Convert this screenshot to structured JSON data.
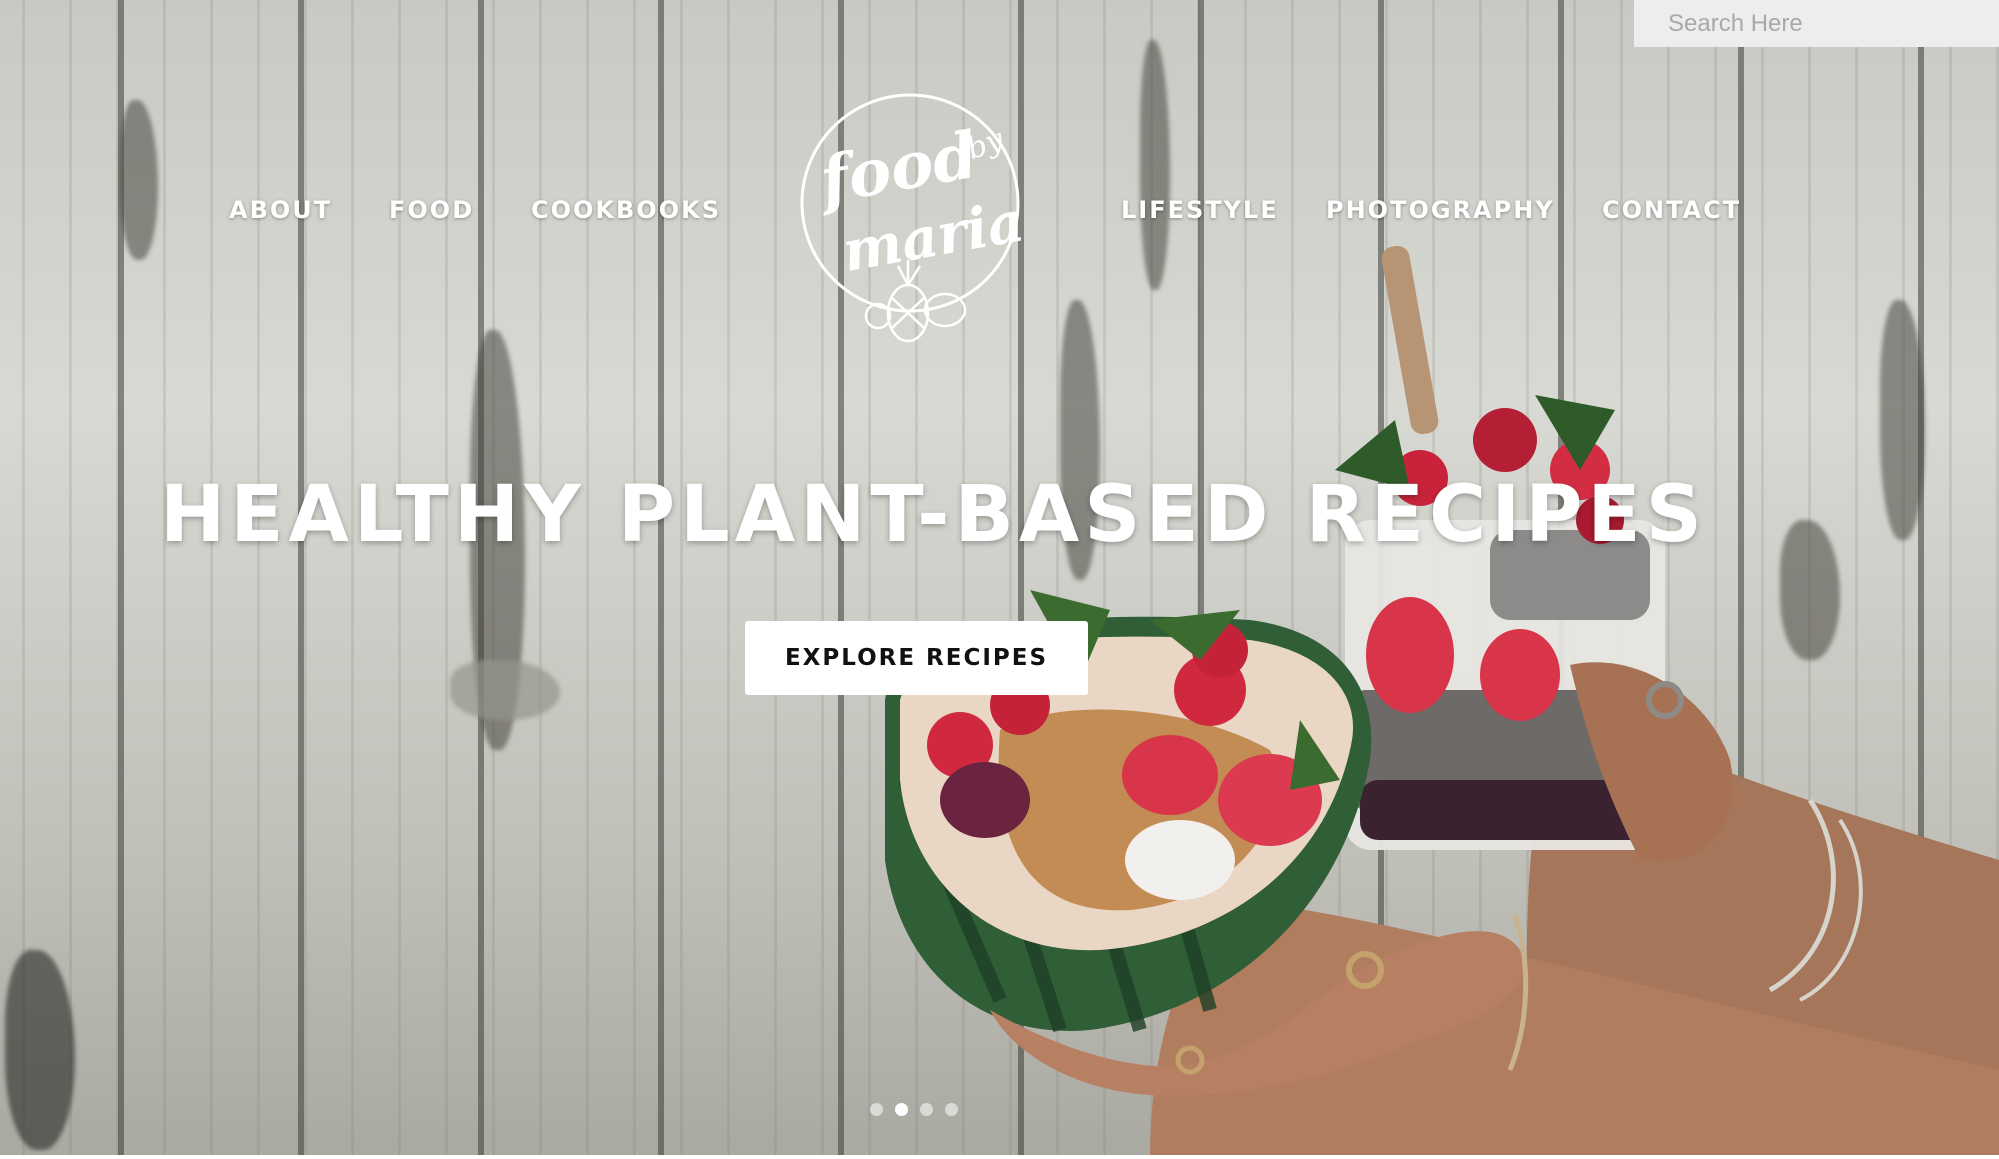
{
  "search": {
    "placeholder": "Search Here"
  },
  "nav": {
    "left": [
      "ABOUT",
      "FOOD",
      "COOKBOOKS"
    ],
    "right": [
      "LIFESTYLE",
      "PHOTOGRAPHY",
      "CONTACT"
    ]
  },
  "logo": {
    "line1": "food",
    "line2": "by",
    "line3": "maria"
  },
  "hero": {
    "headline": "HEALTHY PLANT-BASED RECIPES",
    "cta_label": "EXPLORE RECIPES"
  },
  "slider": {
    "slide_count": 4,
    "active_index": 1
  }
}
